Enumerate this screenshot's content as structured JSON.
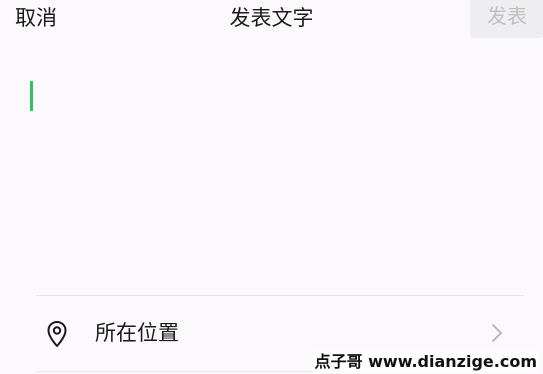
{
  "header": {
    "cancel_label": "取消",
    "title": "发表文字",
    "publish_label": "发表"
  },
  "editor": {
    "text": ""
  },
  "location": {
    "label": "所在位置",
    "icon": "location-pin-icon",
    "chevron": "chevron-right-icon"
  },
  "watermark": {
    "text": "点子哥 www.dianzige.com"
  },
  "colors": {
    "background": "#fbf9fb",
    "caret": "#2fc45b",
    "publish_disabled_bg": "#eeedef",
    "publish_disabled_text": "#c0c0c0"
  }
}
